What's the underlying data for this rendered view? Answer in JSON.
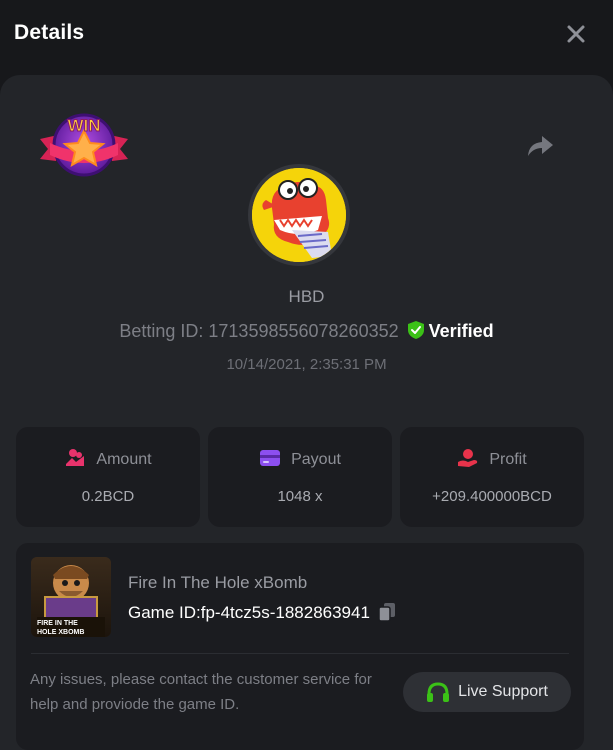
{
  "header": {
    "title": "Details"
  },
  "badge": {
    "text": "WIN"
  },
  "player": {
    "name": "HBD"
  },
  "bet": {
    "betting_id_label": "Betting ID: 1713598556078260352",
    "verified_label": "Verified",
    "datetime": "10/14/2021, 2:35:31 PM"
  },
  "stats": [
    {
      "label": "Amount",
      "value": "0.2BCD",
      "icon": "coins-icon",
      "color": "#e8336c"
    },
    {
      "label": "Payout",
      "value": "1048 x",
      "icon": "wallet-icon",
      "color": "#8c4ff0"
    },
    {
      "label": "Profit",
      "value": "+209.400000BCD",
      "icon": "hand-coin-icon",
      "color": "#e8334b"
    }
  ],
  "game": {
    "name": "Fire In The Hole xBomb",
    "id_label": "Game ID:fp-4tcz5s-1882863941",
    "thumb_text_1": "FIRE IN THE",
    "thumb_text_2": "HOLE XBOMB"
  },
  "support": {
    "message": "Any issues, please contact the customer service for help and proviode the game ID.",
    "button_label": "Live Support"
  },
  "colors": {
    "accent_green": "#3bc117",
    "background": "#17181b",
    "panel": "#232529",
    "card": "#1b1c20"
  }
}
